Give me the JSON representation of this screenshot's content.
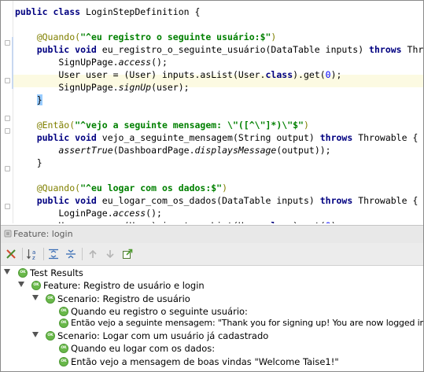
{
  "editor": {
    "lines": [
      [
        {
          "t": "public class ",
          "c": "kw"
        },
        {
          "t": "LoginStepDefinition {",
          "c": ""
        }
      ],
      [],
      [
        {
          "t": "    @Quando(",
          "c": "ann"
        },
        {
          "t": "\"^eu registro o seguinte usuário:$\"",
          "c": "str"
        },
        {
          "t": ")",
          "c": "ann"
        }
      ],
      [
        {
          "t": "    public void ",
          "c": "kw"
        },
        {
          "t": "eu_registro_o_seguinte_usuário(DataTable inputs) ",
          "c": ""
        },
        {
          "t": "throws ",
          "c": "kw"
        },
        {
          "t": "Throwable ",
          "c": ""
        },
        {
          "t": "{",
          "c": "brace"
        }
      ],
      [
        {
          "t": "        SignUpPage.",
          "c": ""
        },
        {
          "t": "access",
          "c": "it"
        },
        {
          "t": "();",
          "c": ""
        }
      ],
      [
        {
          "t": "        User user = (User) inputs.asList(User.",
          "c": ""
        },
        {
          "t": "class",
          "c": "kw"
        },
        {
          "t": ").get(",
          "c": ""
        },
        {
          "t": "0",
          "c": "num"
        },
        {
          "t": ");",
          "c": ""
        }
      ],
      [
        {
          "t": "        SignUpPage.",
          "c": ""
        },
        {
          "t": "signUp",
          "c": "it"
        },
        {
          "t": "(user);",
          "c": ""
        }
      ],
      [
        {
          "t": "    ",
          "c": ""
        },
        {
          "t": "}",
          "c": "brace"
        }
      ],
      [],
      [
        {
          "t": "    @Então(",
          "c": "ann"
        },
        {
          "t": "\"^vejo a seguinte mensagem: \\\"([^\\\"]*)\\\"$\"",
          "c": "str"
        },
        {
          "t": ")",
          "c": "ann"
        }
      ],
      [
        {
          "t": "    public void ",
          "c": "kw"
        },
        {
          "t": "vejo_a_seguinte_mensagem(String output) ",
          "c": ""
        },
        {
          "t": "throws ",
          "c": "kw"
        },
        {
          "t": "Throwable {",
          "c": ""
        }
      ],
      [
        {
          "t": "        ",
          "c": ""
        },
        {
          "t": "assertTrue",
          "c": "it"
        },
        {
          "t": "(DashboardPage.",
          "c": ""
        },
        {
          "t": "displaysMessage",
          "c": "it"
        },
        {
          "t": "(output));",
          "c": ""
        }
      ],
      [
        {
          "t": "    }",
          "c": ""
        }
      ],
      [],
      [
        {
          "t": "    @Quando(",
          "c": "ann"
        },
        {
          "t": "\"^eu logar com os dados:$\"",
          "c": "str"
        },
        {
          "t": ")",
          "c": "ann"
        }
      ],
      [
        {
          "t": "    public void ",
          "c": "kw"
        },
        {
          "t": "eu_logar_com_os_dados(DataTable inputs) ",
          "c": ""
        },
        {
          "t": "throws ",
          "c": "kw"
        },
        {
          "t": "Throwable {",
          "c": ""
        }
      ],
      [
        {
          "t": "        LoginPage.",
          "c": ""
        },
        {
          "t": "access",
          "c": "it"
        },
        {
          "t": "();",
          "c": ""
        }
      ],
      [
        {
          "t": "        User user = (User) inputs.asList(User.",
          "c": ""
        },
        {
          "t": "class",
          "c": "kw"
        },
        {
          "t": ").get(",
          "c": ""
        },
        {
          "t": "0",
          "c": "num"
        },
        {
          "t": ");",
          "c": ""
        }
      ],
      [
        {
          "t": "        LoginPage.",
          "c": ""
        },
        {
          "t": "login",
          "c": "it"
        },
        {
          "t": "(user);",
          "c": ""
        }
      ],
      [
        {
          "t": "    }",
          "c": ""
        }
      ]
    ]
  },
  "feature_panel": {
    "title": "Feature: login"
  },
  "tree": {
    "badge": "OK",
    "root": "Test Results",
    "feature": "Feature: Registro de usuário e login",
    "scenario1": "Scenario: Registro de usuário",
    "step1_1": "Quando eu registro o seguinte usuário:",
    "step1_2": "Então vejo a seguinte mensagem: \"Thank you for signing up! You are now logged in.\"",
    "scenario2": "Scenario: Logar com um usuário já cadastrado",
    "step2_1": "Quando eu logar com os dados:",
    "step2_2": "Então vejo a mensagem de boas vindas \"Welcome Taise1!\""
  }
}
